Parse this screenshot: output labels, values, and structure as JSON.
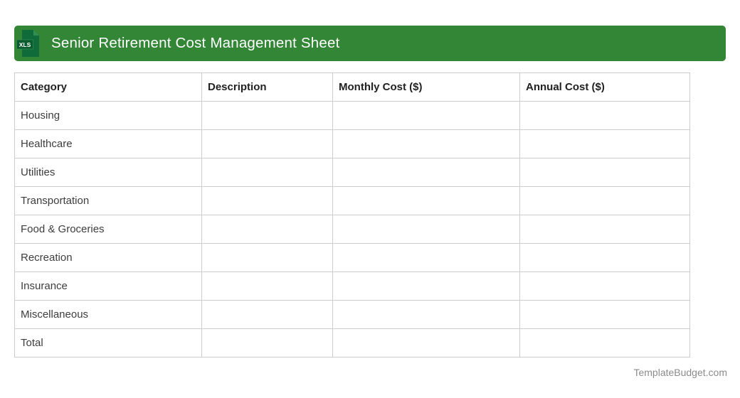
{
  "header": {
    "title": "Senior Retirement Cost Management Sheet",
    "file_badge": "XLS"
  },
  "table": {
    "columns": [
      "Category",
      "Description",
      "Monthly Cost ($)",
      "Annual Cost ($)"
    ],
    "rows": [
      [
        "Housing",
        "",
        "",
        ""
      ],
      [
        "Healthcare",
        "",
        "",
        ""
      ],
      [
        "Utilities",
        "",
        "",
        ""
      ],
      [
        "Transportation",
        "",
        "",
        ""
      ],
      [
        "Food & Groceries",
        "",
        "",
        ""
      ],
      [
        "Recreation",
        "",
        "",
        ""
      ],
      [
        "Insurance",
        "",
        "",
        ""
      ],
      [
        "Miscellaneous",
        "",
        "",
        ""
      ],
      [
        "Total",
        "",
        "",
        ""
      ]
    ]
  },
  "footer": {
    "watermark": "TemplateBudget.com"
  },
  "colors": {
    "title_bar": "#328636",
    "icon_document": "#0f6b3a",
    "icon_fold": "#2e9152",
    "icon_badge": "#0a5b2d",
    "table_border": "#cccccc",
    "header_text": "#212121",
    "cell_text": "#3d3d3d",
    "watermark_text": "#8b8b8b",
    "title_text": "#ffffff"
  }
}
